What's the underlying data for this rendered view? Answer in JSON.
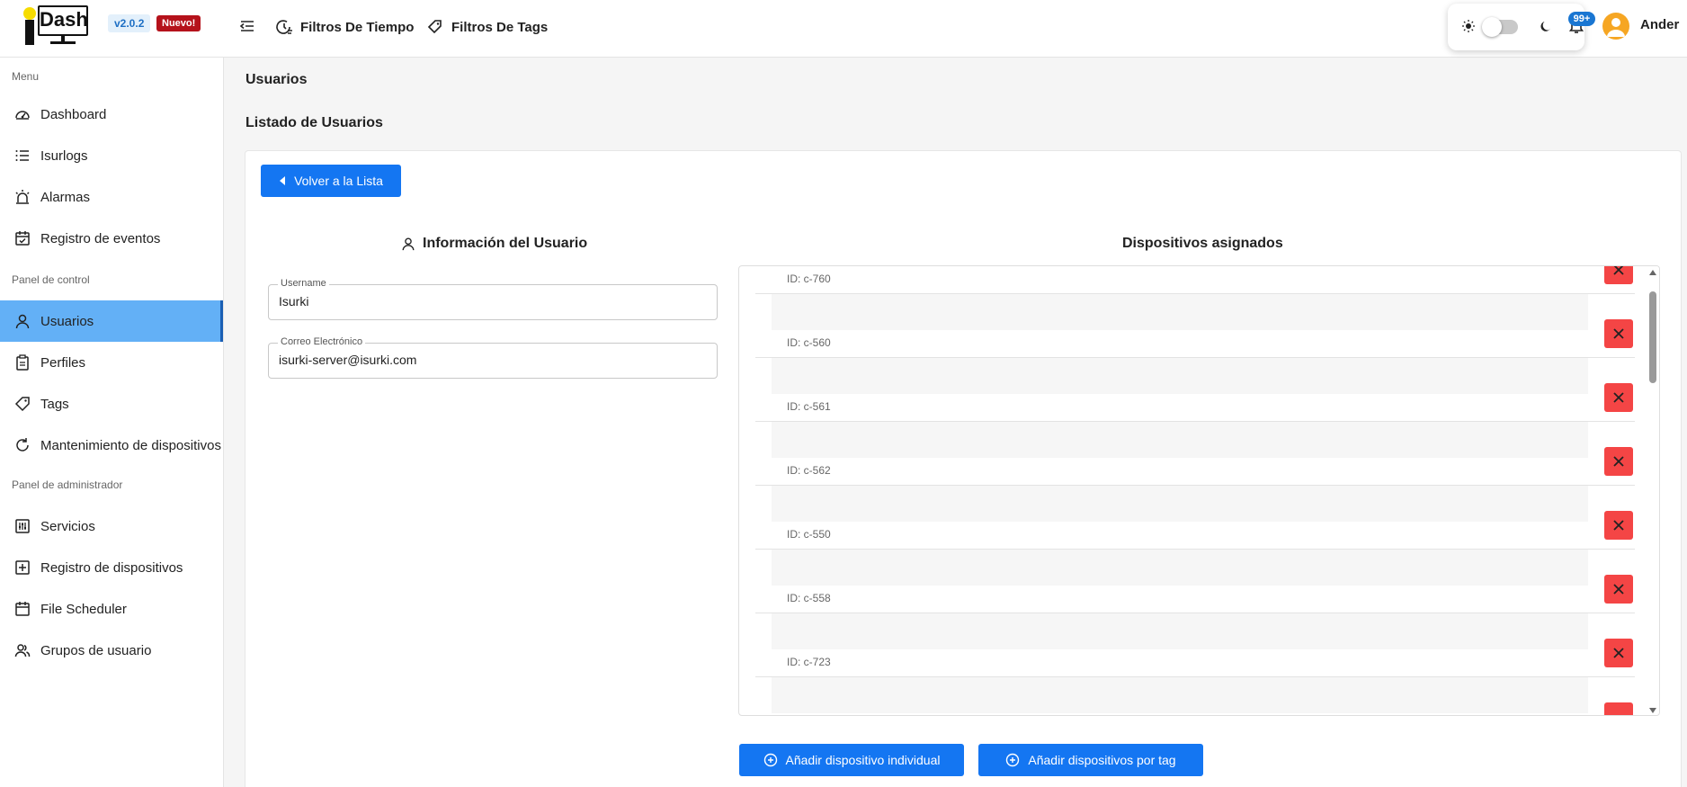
{
  "app": {
    "logo_text": "Dash",
    "version": "v2.0.2",
    "new_badge": "Nuevo!"
  },
  "topbar": {
    "time_filters": "Filtros De Tiempo",
    "tag_filters": "Filtros De Tags",
    "notifications_count": "99+",
    "user_name": "Ander"
  },
  "sidebar": {
    "section_menu": "Menu",
    "section_control": "Panel de control",
    "section_admin": "Panel de administrador",
    "items": [
      {
        "label": "Dashboard",
        "icon": "gauge-icon"
      },
      {
        "label": "Isurlogs",
        "icon": "list-icon"
      },
      {
        "label": "Alarmas",
        "icon": "alarm-light-icon"
      },
      {
        "label": "Registro de eventos",
        "icon": "calendar-check-icon"
      },
      {
        "label": "Usuarios",
        "icon": "user-icon",
        "active": true
      },
      {
        "label": "Perfiles",
        "icon": "clipboard-icon"
      },
      {
        "label": "Tags",
        "icon": "tag-icon"
      },
      {
        "label": "Mantenimiento de dispositivos",
        "icon": "refresh-icon"
      },
      {
        "label": "Servicios",
        "icon": "sliders-icon"
      },
      {
        "label": "Registro de dispositivos",
        "icon": "plus-square-icon"
      },
      {
        "label": "File Scheduler",
        "icon": "calendar-icon"
      },
      {
        "label": "Grupos de usuario",
        "icon": "users-icon"
      }
    ]
  },
  "main": {
    "page_title": "Usuarios",
    "subtitle": "Listado de Usuarios",
    "back_button": "Volver a la Lista",
    "user_info_title": "Información del Usuario",
    "devices_title": "Dispositivos asignados",
    "username_label": "Username",
    "username_value": "Isurki",
    "email_label": "Correo Electrónico",
    "email_value": "isurki-server@isurki.com",
    "devices": [
      {
        "id": "ID: c-760"
      },
      {
        "id": "ID: c-560"
      },
      {
        "id": "ID: c-561"
      },
      {
        "id": "ID: c-562"
      },
      {
        "id": "ID: c-550"
      },
      {
        "id": "ID: c-558"
      },
      {
        "id": "ID: c-723"
      }
    ],
    "add_single_button": "Añadir dispositivo individual",
    "add_tag_button": "Añadir dispositivos por tag"
  },
  "colors": {
    "primary": "#1476f2",
    "sidebar_active": "#63b0f6",
    "delete": "#f44545",
    "new_badge": "#b5121b"
  }
}
